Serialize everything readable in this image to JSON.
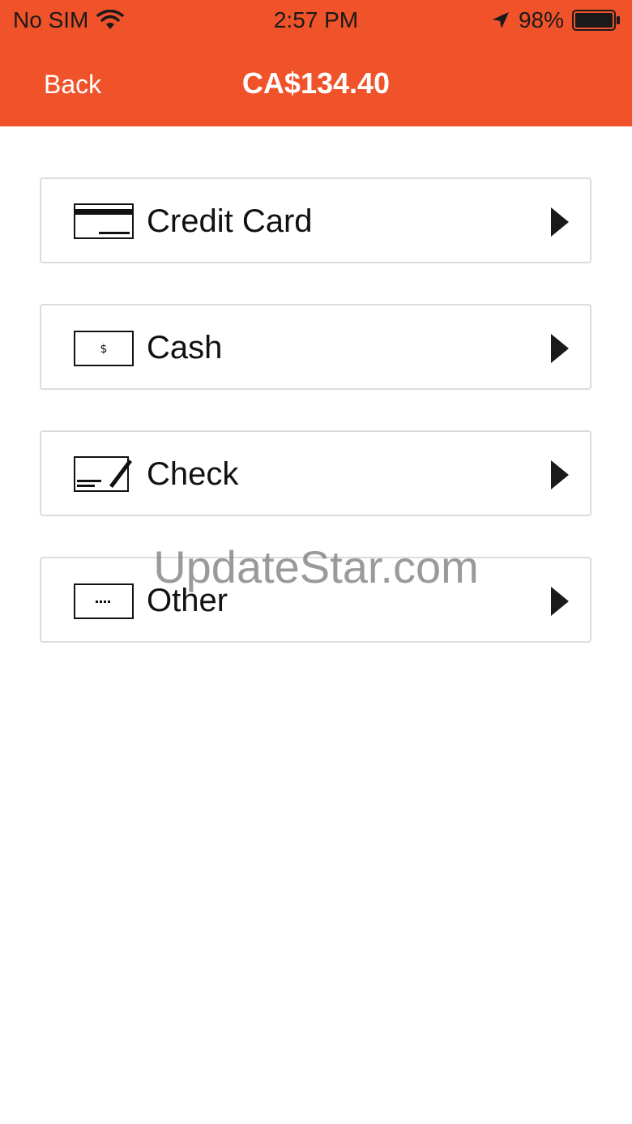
{
  "status_bar": {
    "carrier": "No SIM",
    "time": "2:57 PM",
    "battery": "98%"
  },
  "nav": {
    "back_label": "Back",
    "title": "CA$134.40"
  },
  "payment_methods": [
    {
      "label": "Credit Card",
      "icon": "credit-card-icon"
    },
    {
      "label": "Cash",
      "icon": "cash-icon"
    },
    {
      "label": "Check",
      "icon": "check-icon"
    },
    {
      "label": "Other",
      "icon": "other-icon"
    }
  ],
  "watermark": "UpdateStar.com",
  "colors": {
    "header": "#f0522a",
    "row_border": "#dcdcdc",
    "text": "#111111"
  }
}
